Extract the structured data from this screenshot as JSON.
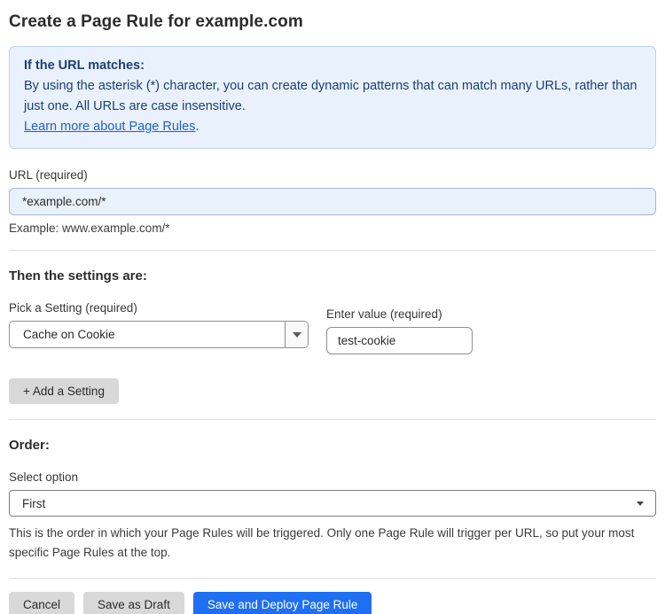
{
  "page": {
    "title": "Create a Page Rule for example.com"
  },
  "info_box": {
    "heading": "If the URL matches:",
    "body": "By using the asterisk (*) character, you can create dynamic patterns that can match many URLs, rather than just one. All URLs are case insensitive.",
    "link_label": "Learn more about Page Rules",
    "link_suffix": "."
  },
  "url_field": {
    "label": "URL (required)",
    "value": "*example.com/*",
    "hint": "Example: www.example.com/*"
  },
  "settings_section": {
    "heading": "Then the settings are:",
    "setting_picker": {
      "label": "Pick a Setting (required)",
      "selected": "Cache on Cookie"
    },
    "value_field": {
      "label": "Enter value (required)",
      "value": "test-cookie"
    },
    "add_button_label": "+ Add a Setting"
  },
  "order_section": {
    "heading": "Order:",
    "select_label": "Select option",
    "selected": "First",
    "help_text": "This is the order in which your Page Rules will be triggered. Only one Page Rule will trigger per URL, so put your most specific Page Rules at the top."
  },
  "actions": {
    "cancel_label": "Cancel",
    "save_draft_label": "Save as Draft",
    "save_deploy_label": "Save and Deploy Page Rule"
  },
  "colors": {
    "primary_blue": "#1f6ff2",
    "info_background": "#e9f1fc",
    "info_border": "#bcd4f1",
    "info_text": "#1d3f72",
    "link_blue": "#2161c6",
    "button_gray": "#d8d8d8"
  },
  "icons": {
    "dropdown_caret": "▼"
  }
}
